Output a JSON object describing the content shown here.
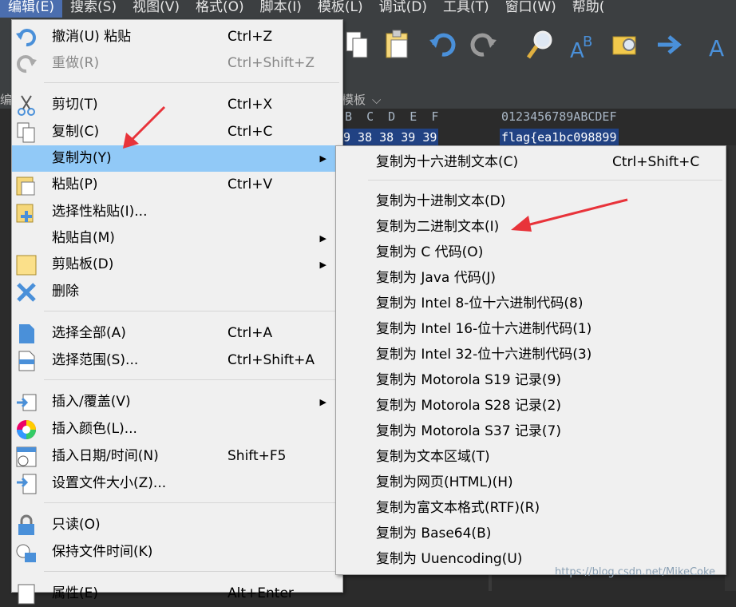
{
  "menubar": {
    "items": [
      {
        "label": "编辑(E)",
        "active": true
      },
      {
        "label": "搜索(S)"
      },
      {
        "label": "视图(V)"
      },
      {
        "label": "格式(O)"
      },
      {
        "label": "脚本(I)"
      },
      {
        "label": "模板(L)"
      },
      {
        "label": "调试(D)"
      },
      {
        "label": "工具(T)"
      },
      {
        "label": "窗口(W)"
      },
      {
        "label": "帮助("
      }
    ]
  },
  "editor": {
    "tab_left": "编",
    "tab_template": "模板",
    "hex_header": "B  C  D  E  F",
    "ascii_header": "0123456789ABCDEF",
    "hex_selected": "9 38 38 39 39",
    "ascii_selected": "flag{ea1bc098899"
  },
  "edit_menu": {
    "items": [
      {
        "label": "撤消(U) 粘贴",
        "shortcut": "Ctrl+Z",
        "icon": "undo-icon"
      },
      {
        "label": "重做(R)",
        "shortcut": "Ctrl+Shift+Z",
        "icon": "redo-icon",
        "disabled": true
      },
      {
        "label": "剪切(T)",
        "shortcut": "Ctrl+X",
        "icon": "scissors-icon"
      },
      {
        "label": "复制(C)",
        "shortcut": "Ctrl+C",
        "icon": "copy-icon"
      },
      {
        "label": "复制为(Y)",
        "shortcut": "",
        "icon": "",
        "submenu": true,
        "highlighted": true
      },
      {
        "label": "粘贴(P)",
        "shortcut": "Ctrl+V",
        "icon": "paste-icon"
      },
      {
        "label": "选择性粘贴(I)...",
        "shortcut": "",
        "icon": "paste-special-icon"
      },
      {
        "label": "粘贴自(M)",
        "shortcut": "",
        "icon": "",
        "submenu": true
      },
      {
        "label": "剪贴板(D)",
        "shortcut": "",
        "icon": "clipboard-icon",
        "submenu": true
      },
      {
        "label": "删除",
        "shortcut": "",
        "icon": "delete-icon"
      },
      {
        "label": "选择全部(A)",
        "shortcut": "Ctrl+A",
        "icon": "select-all-icon"
      },
      {
        "label": "选择范围(S)...",
        "shortcut": "Ctrl+Shift+A",
        "icon": "select-range-icon"
      },
      {
        "label": "插入/覆盖(V)",
        "shortcut": "",
        "icon": "insert-icon",
        "submenu": true
      },
      {
        "label": "插入颜色(L)...",
        "shortcut": "",
        "icon": "color-wheel-icon"
      },
      {
        "label": "插入日期/时间(N)",
        "shortcut": "Shift+F5",
        "icon": "calendar-icon"
      },
      {
        "label": "设置文件大小(Z)...",
        "shortcut": "",
        "icon": "file-size-icon"
      },
      {
        "label": "只读(O)",
        "shortcut": "",
        "icon": "lock-icon"
      },
      {
        "label": "保持文件时间(K)",
        "shortcut": "",
        "icon": "lock-clock-icon"
      },
      {
        "label": "属性(E)",
        "shortcut": "Alt+Enter",
        "icon": "properties-icon"
      }
    ]
  },
  "copy_as_menu": {
    "items": [
      {
        "label": "复制为十六进制文本(C)",
        "shortcut": "Ctrl+Shift+C"
      },
      {
        "label": "复制为十进制文本(D)",
        "shortcut": ""
      },
      {
        "label": "复制为二进制文本(I)",
        "shortcut": ""
      },
      {
        "label": "复制为 C 代码(O)",
        "shortcut": ""
      },
      {
        "label": "复制为 Java 代码(J)",
        "shortcut": ""
      },
      {
        "label": "复制为 Intel 8-位十六进制代码(8)",
        "shortcut": ""
      },
      {
        "label": "复制为 Intel 16-位十六进制代码(1)",
        "shortcut": ""
      },
      {
        "label": "复制为 Intel 32-位十六进制代码(3)",
        "shortcut": ""
      },
      {
        "label": "复制为 Motorola S19 记录(9)",
        "shortcut": ""
      },
      {
        "label": "复制为 Motorola S28 记录(2)",
        "shortcut": ""
      },
      {
        "label": "复制为 Motorola S37 记录(7)",
        "shortcut": ""
      },
      {
        "label": "复制为文本区域(T)",
        "shortcut": ""
      },
      {
        "label": "复制为网页(HTML)(H)",
        "shortcut": ""
      },
      {
        "label": "复制为富文本格式(RTF)(R)",
        "shortcut": ""
      },
      {
        "label": "复制为 Base64(B)",
        "shortcut": ""
      },
      {
        "label": "复制为 Uuencoding(U)",
        "shortcut": ""
      }
    ]
  },
  "watermark": "https://blog.csdn.net/MikeCoke",
  "colors": {
    "annotation_arrow": "#e8333a",
    "highlight": "#91c9f7",
    "selection": "#214283"
  }
}
